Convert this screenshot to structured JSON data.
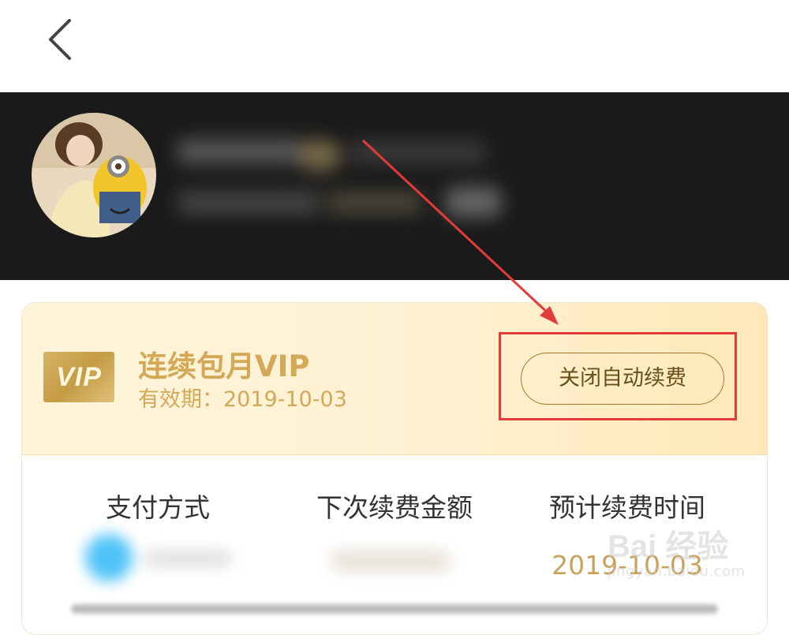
{
  "membership": {
    "plan_name": "连续包月VIP",
    "badge_text": "VIP",
    "expiry_label": "有效期：",
    "expiry_date": "2019-10-03",
    "cancel_button": "关闭自动续费"
  },
  "details": {
    "col_payment_method": "支付方式",
    "col_next_amount": "下次续费金额",
    "col_expected_time": "预计续费时间",
    "expected_renew_date": "2019-10-03"
  },
  "watermark": {
    "brand": "Bai 经验",
    "url": "jingyan.baidu.com"
  },
  "icons": {
    "back": "chevron-left-icon"
  },
  "colors": {
    "gold": "#d3a856",
    "dark_gold_text": "#6b4f1a",
    "hero_bg": "#1a1a1a",
    "highlight_red": "#e33a3a"
  }
}
